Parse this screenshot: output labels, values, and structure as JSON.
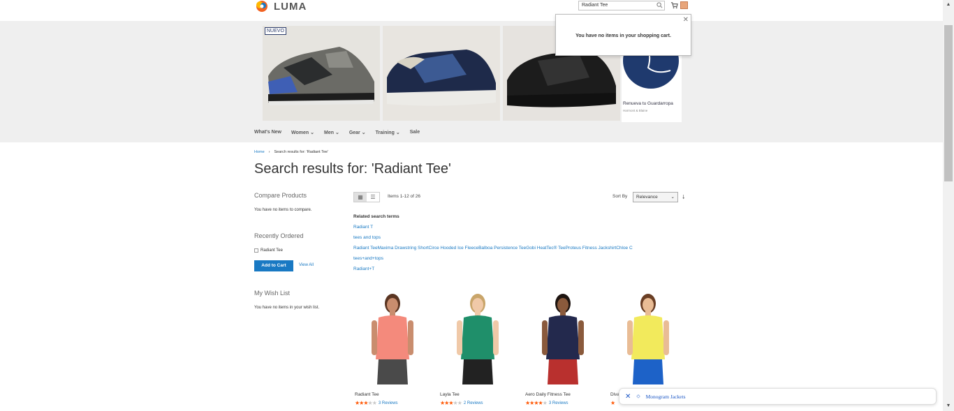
{
  "header": {
    "logo_text": "LUMA",
    "search_value": "Radiant Tee",
    "icons": [
      "search-icon",
      "cart-icon",
      "avatar-chip"
    ]
  },
  "banner": {
    "badge": "NUEVO",
    "ad_title": "Renueva tu Guardarropa",
    "ad_sub": "Harmont & Blaine"
  },
  "minicart": {
    "message": "You have no items in your shopping cart."
  },
  "nav": {
    "items": [
      "What's New",
      "Women",
      "Men",
      "Gear",
      "Training",
      "Sale"
    ]
  },
  "breadcrumb": {
    "home": "Home",
    "current": "Search results for: 'Radiant Tee'"
  },
  "page_title": "Search results for: 'Radiant Tee'",
  "sidebar": {
    "compare_heading": "Compare Products",
    "compare_text": "You have no items to compare.",
    "recent_heading": "Recently Ordered",
    "recent_item": "Radiant Tee",
    "add_to_cart": "Add to Cart",
    "view_all": "View All",
    "wishlist_heading": "My Wish List",
    "wishlist_text": "You have no items in your wish list."
  },
  "toolbar": {
    "items_count": "Items 1-12 of 26",
    "sort_label": "Sort By",
    "sort_value": "Relevance"
  },
  "related": {
    "heading": "Related search terms",
    "terms": [
      "Radiant T",
      "tees and tops",
      "Radiant TeeMaxima Drawstring ShortCirce Hooded Ice FleeceBalboa Persistence TeeGobi HeatTec® TeeProteus Fitness JackshirtChloe C",
      "tees+and+tops",
      "Radiant+T"
    ]
  },
  "products": [
    {
      "name": "Radiant Tee",
      "stars": 3,
      "reviews": "3 Reviews",
      "shirt": "#f48a7c",
      "skin": "#c98d6e",
      "hair": "#5a3522",
      "bottom": "#4a4a4a"
    },
    {
      "name": "Layla Tee",
      "stars": 3,
      "reviews": "2 Reviews",
      "shirt": "#1f8f6a",
      "skin": "#f0c9a8",
      "hair": "#c9a56a",
      "bottom": "#222222"
    },
    {
      "name": "Aero Daily Fitness Tee",
      "stars": 4,
      "reviews": "3 Reviews",
      "shirt": "#23294d",
      "skin": "#8a5a3c",
      "hair": "#1d1410",
      "bottom": "#b9302e"
    },
    {
      "name": "Diva",
      "stars": 1,
      "reviews": "",
      "shirt": "#f2ea5c",
      "skin": "#e9bc95",
      "hair": "#6a3e24",
      "bottom": "#1d62c8"
    }
  ],
  "bottom_pill": {
    "label": "Monogram Jackets"
  }
}
